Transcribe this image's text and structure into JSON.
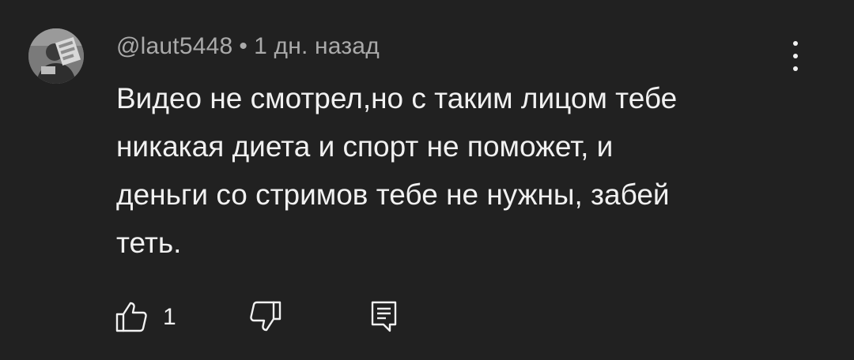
{
  "comment": {
    "author": "@laut5448",
    "separator": "•",
    "timestamp": "1 дн. назад",
    "text_lines": [
      "Видео не смотрел,но с таким лицом тебе",
      "никакая диета и спорт не поможет, и",
      "деньги со стримов тебе не нужны, забей",
      "теть."
    ],
    "like_count": "1"
  },
  "icons": {
    "avatar": "avatar-image",
    "menu": "more-vertical-icon",
    "like": "thumb-up-icon",
    "dislike": "thumb-down-icon",
    "reply": "reply-comment-icon"
  },
  "colors": {
    "background": "#212121",
    "text": "#f1f1f1",
    "meta": "#aaaaaa"
  }
}
